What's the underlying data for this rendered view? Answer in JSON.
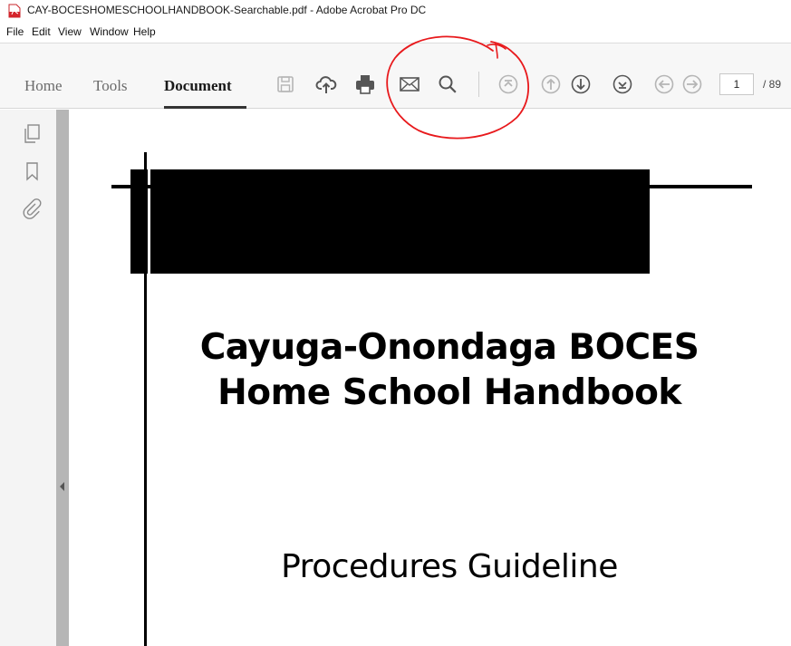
{
  "window": {
    "title": "CAY-BOCESHOMESCHOOLHANDBOOK-Searchable.pdf - Adobe Acrobat Pro DC",
    "app_icon": "acrobat-pdf-icon"
  },
  "menubar": {
    "items": [
      "File",
      "Edit",
      "View",
      "Window",
      "Help"
    ]
  },
  "toolbar": {
    "tabs": [
      {
        "label": "Home",
        "active": false
      },
      {
        "label": "Tools",
        "active": false
      },
      {
        "label": "Document",
        "active": true
      }
    ],
    "buttons": [
      {
        "icon": "save-icon",
        "enabled": false
      },
      {
        "icon": "cloud-upload-icon",
        "enabled": true
      },
      {
        "icon": "print-icon",
        "enabled": true
      },
      {
        "icon": "email-icon",
        "enabled": true
      },
      {
        "icon": "search-icon",
        "enabled": true
      },
      {
        "icon": "first-page-icon",
        "enabled": false
      },
      {
        "icon": "previous-page-icon",
        "enabled": false
      },
      {
        "icon": "next-page-icon",
        "enabled": true
      },
      {
        "icon": "last-page-icon",
        "enabled": true
      },
      {
        "icon": "back-icon",
        "enabled": false
      },
      {
        "icon": "forward-icon",
        "enabled": false
      }
    ],
    "page_current": "1",
    "page_total": "/ 89"
  },
  "sidebar": {
    "icons": [
      "page-thumbnails-icon",
      "bookmark-icon",
      "attachment-icon"
    ]
  },
  "document": {
    "heading_line1": "Cayuga-Onondaga BOCES",
    "heading_line2": "Home School Handbook",
    "subheading": "Procedures Guideline"
  },
  "colors": {
    "annotation_circle": "#e8191c",
    "pdf_icon_red": "#d4242b",
    "toolbar_bg": "#f7f7f7",
    "disabled_icon": "#b5b5b5",
    "enabled_icon": "#555555"
  }
}
